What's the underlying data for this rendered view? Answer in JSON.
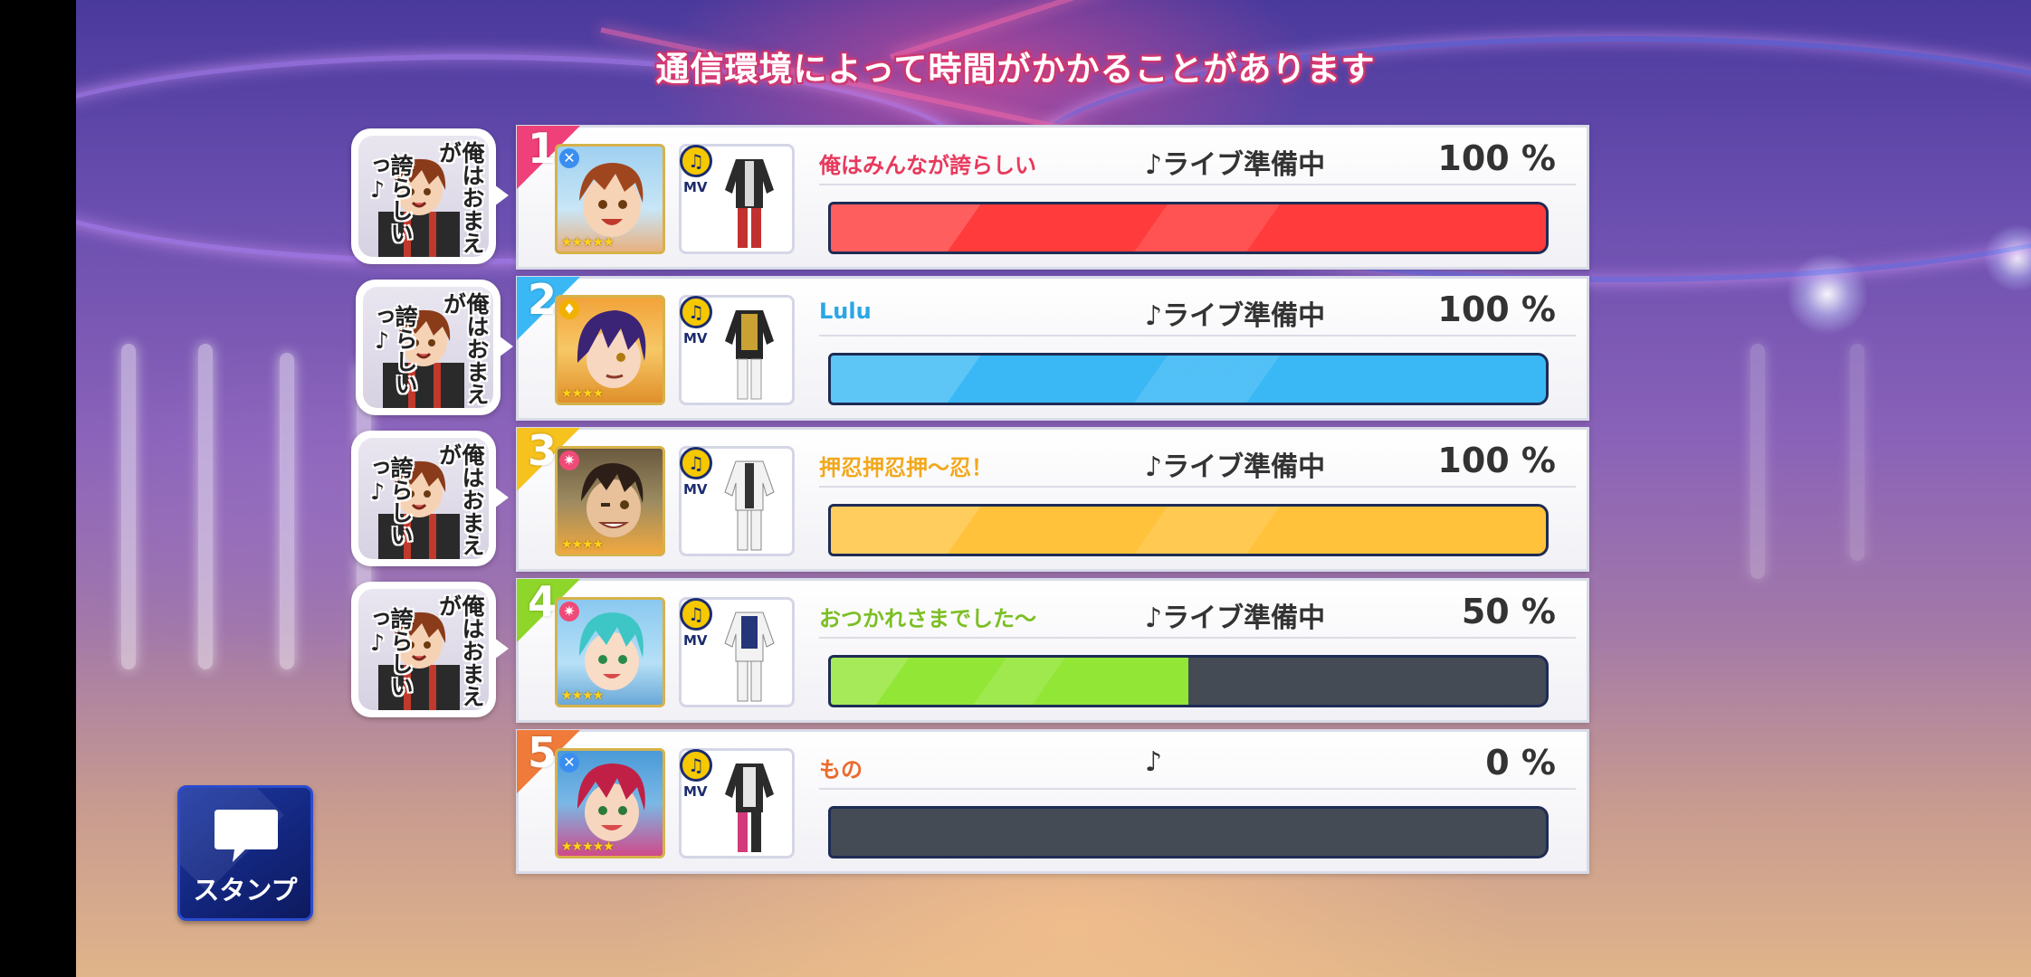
{
  "header": {
    "notice": "通信環境によって時間がかかることがあります"
  },
  "colors": {
    "bar1": "#ff3b3b",
    "bar2": "#3ab8f5",
    "bar3": "#ffc23a",
    "bar4": "#92e635",
    "empty_track": "#454b55"
  },
  "stamps": [
    {
      "text_right": "俺はおまえが",
      "text_left": "誇らしいっ♪"
    },
    {
      "text_right": "俺はおまえが",
      "text_left": "誇らしいっ♪"
    },
    {
      "text_right": "俺はおまえが",
      "text_left": "誇らしいっ♪"
    },
    {
      "text_right": "俺はおまえが",
      "text_left": "誇らしいっ♪"
    }
  ],
  "players": [
    {
      "rank": "1",
      "name": "俺はみんなが誇らしい",
      "status": "♪ライブ準備中",
      "percent": "100 %",
      "progress": 1.0,
      "mv_label": "MV",
      "stars": "★★★★★",
      "attr": "✕"
    },
    {
      "rank": "2",
      "name": "Lulu",
      "status": "♪ライブ準備中",
      "percent": "100 %",
      "progress": 1.0,
      "mv_label": "MV",
      "stars": "★★★★",
      "attr": "♦"
    },
    {
      "rank": "3",
      "name": "押忍押忍押〜忍！",
      "status": "♪ライブ準備中",
      "percent": "100 %",
      "progress": 1.0,
      "mv_label": "MV",
      "stars": "★★★★",
      "attr": "✷"
    },
    {
      "rank": "4",
      "name": "おつかれさまでした〜",
      "status": "♪ライブ準備中",
      "percent": "50 %",
      "progress": 0.5,
      "mv_label": "MV",
      "stars": "★★★★",
      "attr": "✷"
    },
    {
      "rank": "5",
      "name": "もの",
      "status": "♪",
      "percent": "0 %",
      "progress": 0.0,
      "mv_label": "MV",
      "stars": "★★★★★",
      "attr": "✕"
    }
  ],
  "stamp_button": {
    "label": "スタンプ",
    "icon": "chat-bubble-icon"
  }
}
